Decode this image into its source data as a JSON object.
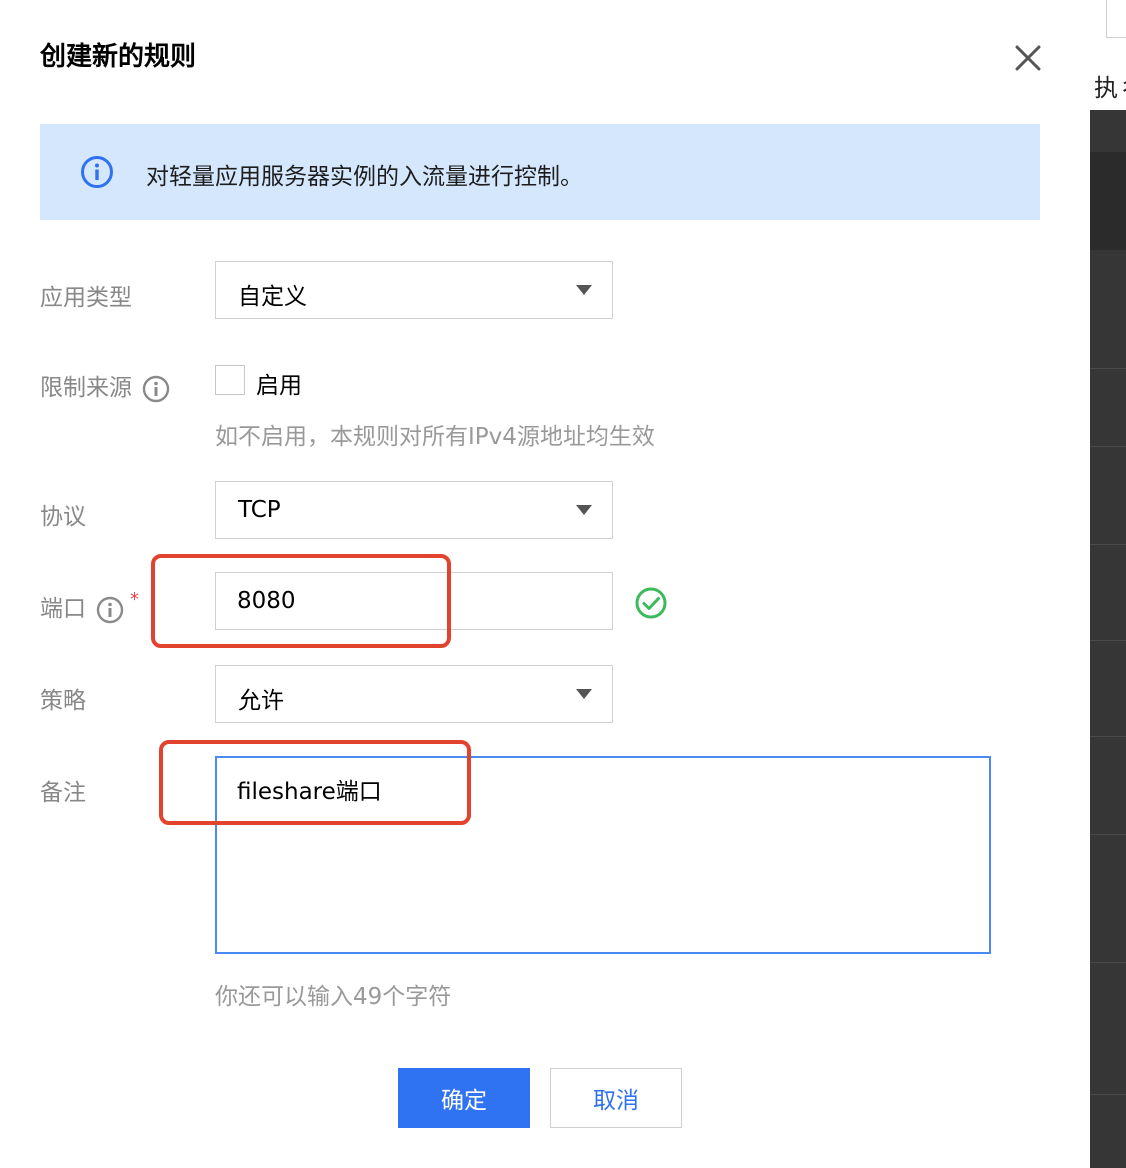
{
  "dialog": {
    "title": "创建新的规则",
    "info": "对轻量应用服务器实例的入流量进行控制。"
  },
  "form": {
    "app_type": {
      "label": "应用类型",
      "value": "自定义"
    },
    "source_limit": {
      "label": "限制来源",
      "checkbox_label": "启用",
      "checked": false,
      "helper": "如不启用，本规则对所有IPv4源地址均生效"
    },
    "protocol": {
      "label": "协议",
      "value": "TCP"
    },
    "port": {
      "label": "端口",
      "required_mark": "*",
      "value": "8080"
    },
    "policy": {
      "label": "策略",
      "value": "允许"
    },
    "remark": {
      "label": "备注",
      "value": "fileshare端口",
      "helper": "你还可以输入49个字符"
    }
  },
  "buttons": {
    "confirm": "确定",
    "cancel": "取消"
  },
  "background": {
    "partial_text": "执彳"
  },
  "colors": {
    "primary": "#2f72f2",
    "info_bg": "#d5e7fd",
    "success": "#3dba5c",
    "annotation": "#e2432f"
  },
  "icons": {
    "close": "close-icon",
    "info": "info-circle-icon",
    "hint": "info-circle-icon",
    "valid": "check-circle-icon",
    "dropdown": "caret-down-icon"
  }
}
